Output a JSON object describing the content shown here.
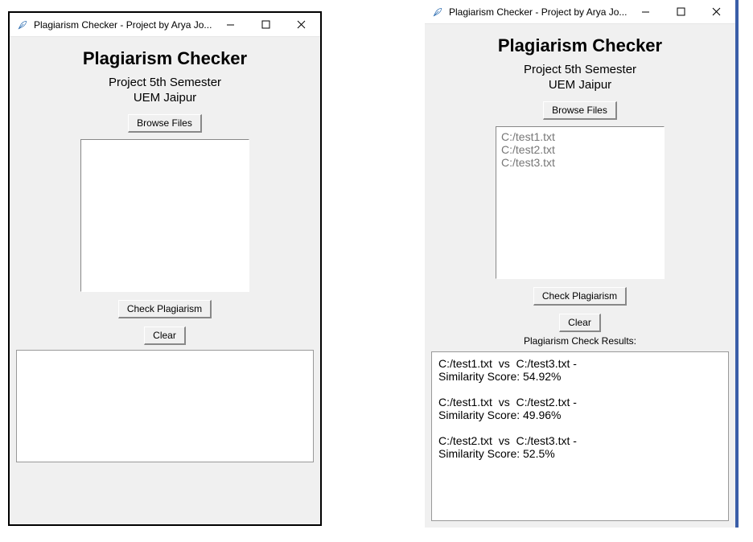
{
  "window": {
    "title": "Plagiarism Checker - Project by Arya Jo...",
    "icon_name": "feather-icon"
  },
  "app": {
    "title": "Plagiarism Checker",
    "subtitle_line1": "Project 5th Semester",
    "subtitle_line2": "UEM Jaipur",
    "browse_btn": "Browse Files",
    "check_btn": "Check Plagiarism",
    "clear_btn": "Clear",
    "results_label": "Plagiarism Check Results:"
  },
  "left": {
    "file_list": "",
    "results": ""
  },
  "right": {
    "file_list": "C:/test1.txt\nC:/test2.txt\nC:/test3.txt",
    "results": "C:/test1.txt  vs  C:/test3.txt -\nSimilarity Score: 54.92%\n\nC:/test1.txt  vs  C:/test2.txt -\nSimilarity Score: 49.96%\n\nC:/test2.txt  vs  C:/test3.txt -\nSimilarity Score: 52.5%"
  }
}
